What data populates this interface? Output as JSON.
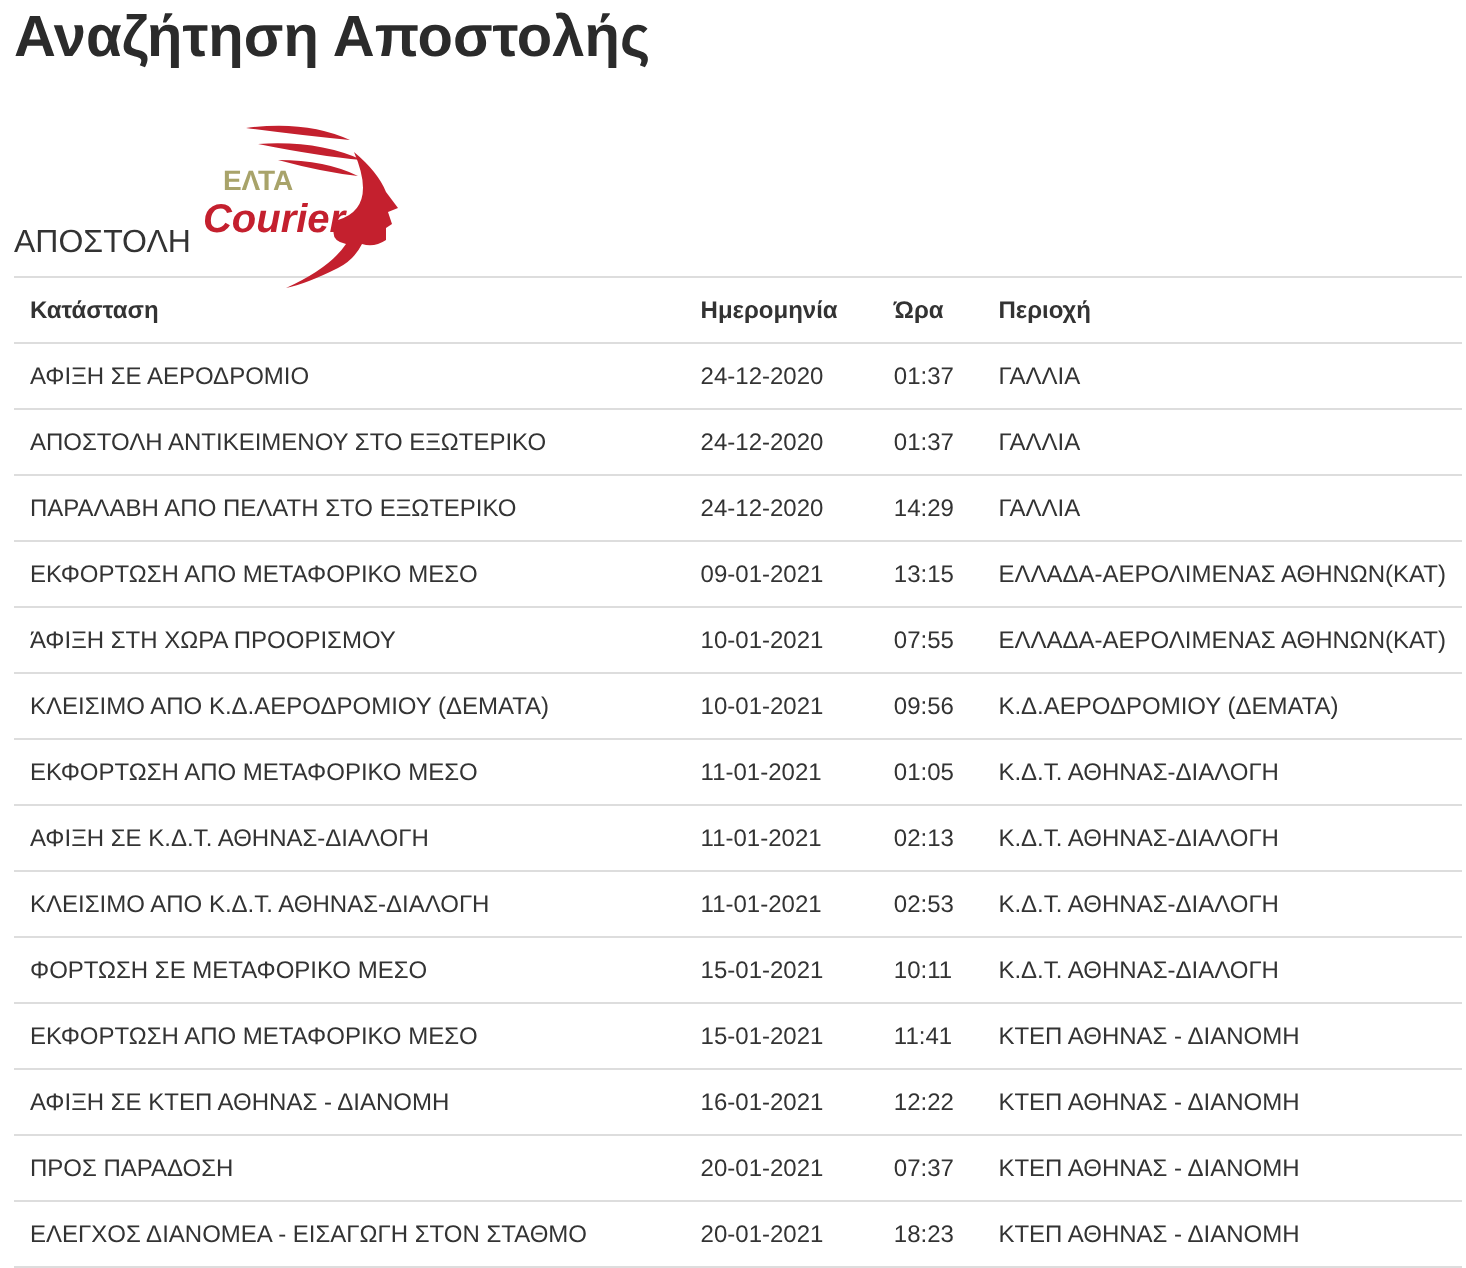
{
  "title": "Αναζήτηση Αποστολής",
  "logo": {
    "line_1": "ΕΛΤΑ",
    "line_2": "Courier"
  },
  "section_label": "ΑΠΟΣΤΟΛΗ",
  "table": {
    "columns": [
      "Κατάσταση",
      "Ημερομηνία",
      "Ώρα",
      "Περιοχή"
    ],
    "rows": [
      [
        "ΑΦΙΞΗ ΣΕ ΑΕΡΟΔΡΟΜΙΟ",
        "24-12-2020",
        "01:37",
        "ΓΑΛΛΙΑ"
      ],
      [
        "ΑΠΟΣΤΟΛΗ ΑΝΤΙΚΕΙΜΕΝΟΥ ΣΤΟ ΕΞΩΤΕΡΙΚΟ",
        "24-12-2020",
        "01:37",
        "ΓΑΛΛΙΑ"
      ],
      [
        "ΠΑΡΑΛΑΒΗ ΑΠΟ ΠΕΛΑΤΗ ΣΤΟ ΕΞΩΤΕΡΙΚΟ",
        "24-12-2020",
        "14:29",
        "ΓΑΛΛΙΑ"
      ],
      [
        "ΕΚΦΟΡΤΩΣΗ ΑΠΟ ΜΕΤΑΦΟΡΙΚΟ ΜΕΣΟ",
        "09-01-2021",
        "13:15",
        "ΕΛΛΑΔΑ-ΑΕΡΟΛΙΜΕΝΑΣ ΑΘΗΝΩΝ(ΚΑΤ)"
      ],
      [
        "ΆΦΙΞΗ ΣΤΗ ΧΩΡΑ ΠΡΟΟΡΙΣΜΟΥ",
        "10-01-2021",
        "07:55",
        "ΕΛΛΑΔΑ-ΑΕΡΟΛΙΜΕΝΑΣ ΑΘΗΝΩΝ(ΚΑΤ)"
      ],
      [
        "ΚΛΕΙΣΙΜΟ ΑΠΟ Κ.Δ.ΑΕΡΟΔΡΟΜΙΟΥ (ΔΕΜΑΤΑ)",
        "10-01-2021",
        "09:56",
        "Κ.Δ.ΑΕΡΟΔΡΟΜΙΟΥ (ΔΕΜΑΤΑ)"
      ],
      [
        "ΕΚΦΟΡΤΩΣΗ ΑΠΟ ΜΕΤΑΦΟΡΙΚΟ ΜΕΣΟ",
        "11-01-2021",
        "01:05",
        "Κ.Δ.Τ. ΑΘΗΝΑΣ-ΔΙΑΛΟΓΗ"
      ],
      [
        "ΑΦΙΞΗ ΣΕ Κ.Δ.Τ. ΑΘΗΝΑΣ-ΔΙΑΛΟΓΗ",
        "11-01-2021",
        "02:13",
        "Κ.Δ.Τ. ΑΘΗΝΑΣ-ΔΙΑΛΟΓΗ"
      ],
      [
        "ΚΛΕΙΣΙΜΟ ΑΠΟ Κ.Δ.Τ. ΑΘΗΝΑΣ-ΔΙΑΛΟΓΗ",
        "11-01-2021",
        "02:53",
        "Κ.Δ.Τ. ΑΘΗΝΑΣ-ΔΙΑΛΟΓΗ"
      ],
      [
        "ΦΟΡΤΩΣΗ ΣΕ ΜΕΤΑΦΟΡΙΚΟ ΜΕΣΟ",
        "15-01-2021",
        "10:11",
        "Κ.Δ.Τ. ΑΘΗΝΑΣ-ΔΙΑΛΟΓΗ"
      ],
      [
        "ΕΚΦΟΡΤΩΣΗ ΑΠΟ ΜΕΤΑΦΟΡΙΚΟ ΜΕΣΟ",
        "15-01-2021",
        "11:41",
        "ΚΤΕΠ ΑΘΗΝΑΣ - ΔΙΑΝΟΜΗ"
      ],
      [
        "ΑΦΙΞΗ ΣΕ ΚΤΕΠ ΑΘΗΝΑΣ - ΔΙΑΝΟΜΗ",
        "16-01-2021",
        "12:22",
        "ΚΤΕΠ ΑΘΗΝΑΣ - ΔΙΑΝΟΜΗ"
      ],
      [
        "ΠΡΟΣ ΠΑΡΑΔΟΣΗ",
        "20-01-2021",
        "07:37",
        "ΚΤΕΠ ΑΘΗΝΑΣ - ΔΙΑΝΟΜΗ"
      ],
      [
        "ΕΛΕΓΧΟΣ ΔΙΑΝΟΜΕΑ - ΕΙΣΑΓΩΓΗ ΣΤΟΝ ΣΤΑΘΜΟ",
        "20-01-2021",
        "18:23",
        "ΚΤΕΠ ΑΘΗΝΑΣ - ΔΙΑΝΟΜΗ"
      ]
    ]
  }
}
